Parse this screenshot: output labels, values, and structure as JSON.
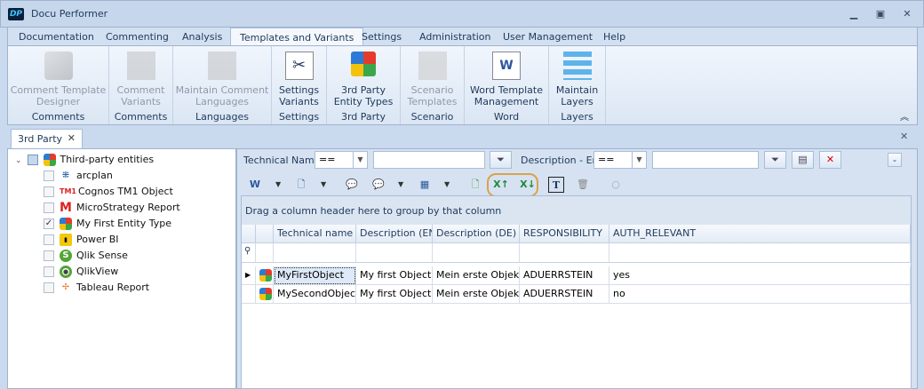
{
  "app": {
    "title": "Docu Performer",
    "logo": "DP"
  },
  "window": {
    "minimize": "minimize-icon",
    "restore": "restore-icon",
    "close": "close-icon"
  },
  "menu_tabs": [
    "Documentation",
    "Commenting",
    "Analysis",
    "Templates and Variants",
    "Settings",
    "Administration",
    "User Management",
    "Help"
  ],
  "active_tab": "Templates and Variants",
  "ribbon": [
    {
      "label": "Comment Template Designer",
      "group": "Comments",
      "enabled": false
    },
    {
      "label": "Comment Variants",
      "group": "Comments",
      "enabled": false
    },
    {
      "label": "Maintain Comment Languages",
      "group": "Languages",
      "enabled": false
    },
    {
      "label": "Settings Variants",
      "group": "Settings",
      "enabled": true
    },
    {
      "label": "3rd Party Entity Types",
      "group": "3rd Party",
      "enabled": true
    },
    {
      "label": "Scenario Templates",
      "group": "Scenario",
      "enabled": false
    },
    {
      "label": "Word Template Management",
      "group": "Word",
      "enabled": true
    },
    {
      "label": "Maintain Layers",
      "group": "Layers",
      "enabled": true
    }
  ],
  "doc_tab": {
    "label": "3rd Party"
  },
  "tree": {
    "root": "Third-party entities",
    "items": [
      {
        "label": "arcplan",
        "checked": false
      },
      {
        "label": "Cognos TM1 Object",
        "checked": false,
        "icon_text": "TM1"
      },
      {
        "label": "MicroStrategy Report",
        "checked": false,
        "icon_text": "M"
      },
      {
        "label": "My First Entity Type",
        "checked": true
      },
      {
        "label": "Power BI",
        "checked": false
      },
      {
        "label": "Qlik Sense",
        "checked": false,
        "icon_text": "S"
      },
      {
        "label": "QlikView",
        "checked": false
      },
      {
        "label": "Tableau Report",
        "checked": false
      }
    ]
  },
  "filter": {
    "tech_label": "Technical Name",
    "tech_op": "==",
    "tech_value": "",
    "desc_label": "Description - En",
    "desc_op": "==",
    "desc_value": ""
  },
  "grid": {
    "group_hint": "Drag a column header here to group by that column",
    "columns": [
      "Technical name",
      "Description (EN)",
      "Description (DE)",
      "RESPONSIBILITY",
      "AUTH_RELEVANT"
    ],
    "rows": [
      [
        "MyFirstObject",
        "My first Object",
        "Mein erste Objekt",
        "ADUERRSTEIN",
        "yes"
      ],
      [
        "MySecondObject",
        "My first Object",
        "Mein erste Objekt",
        "ADUERRSTEIN",
        "no"
      ]
    ]
  },
  "colors": {
    "highlight": "#d9a34b",
    "accent": "#1e395b"
  }
}
